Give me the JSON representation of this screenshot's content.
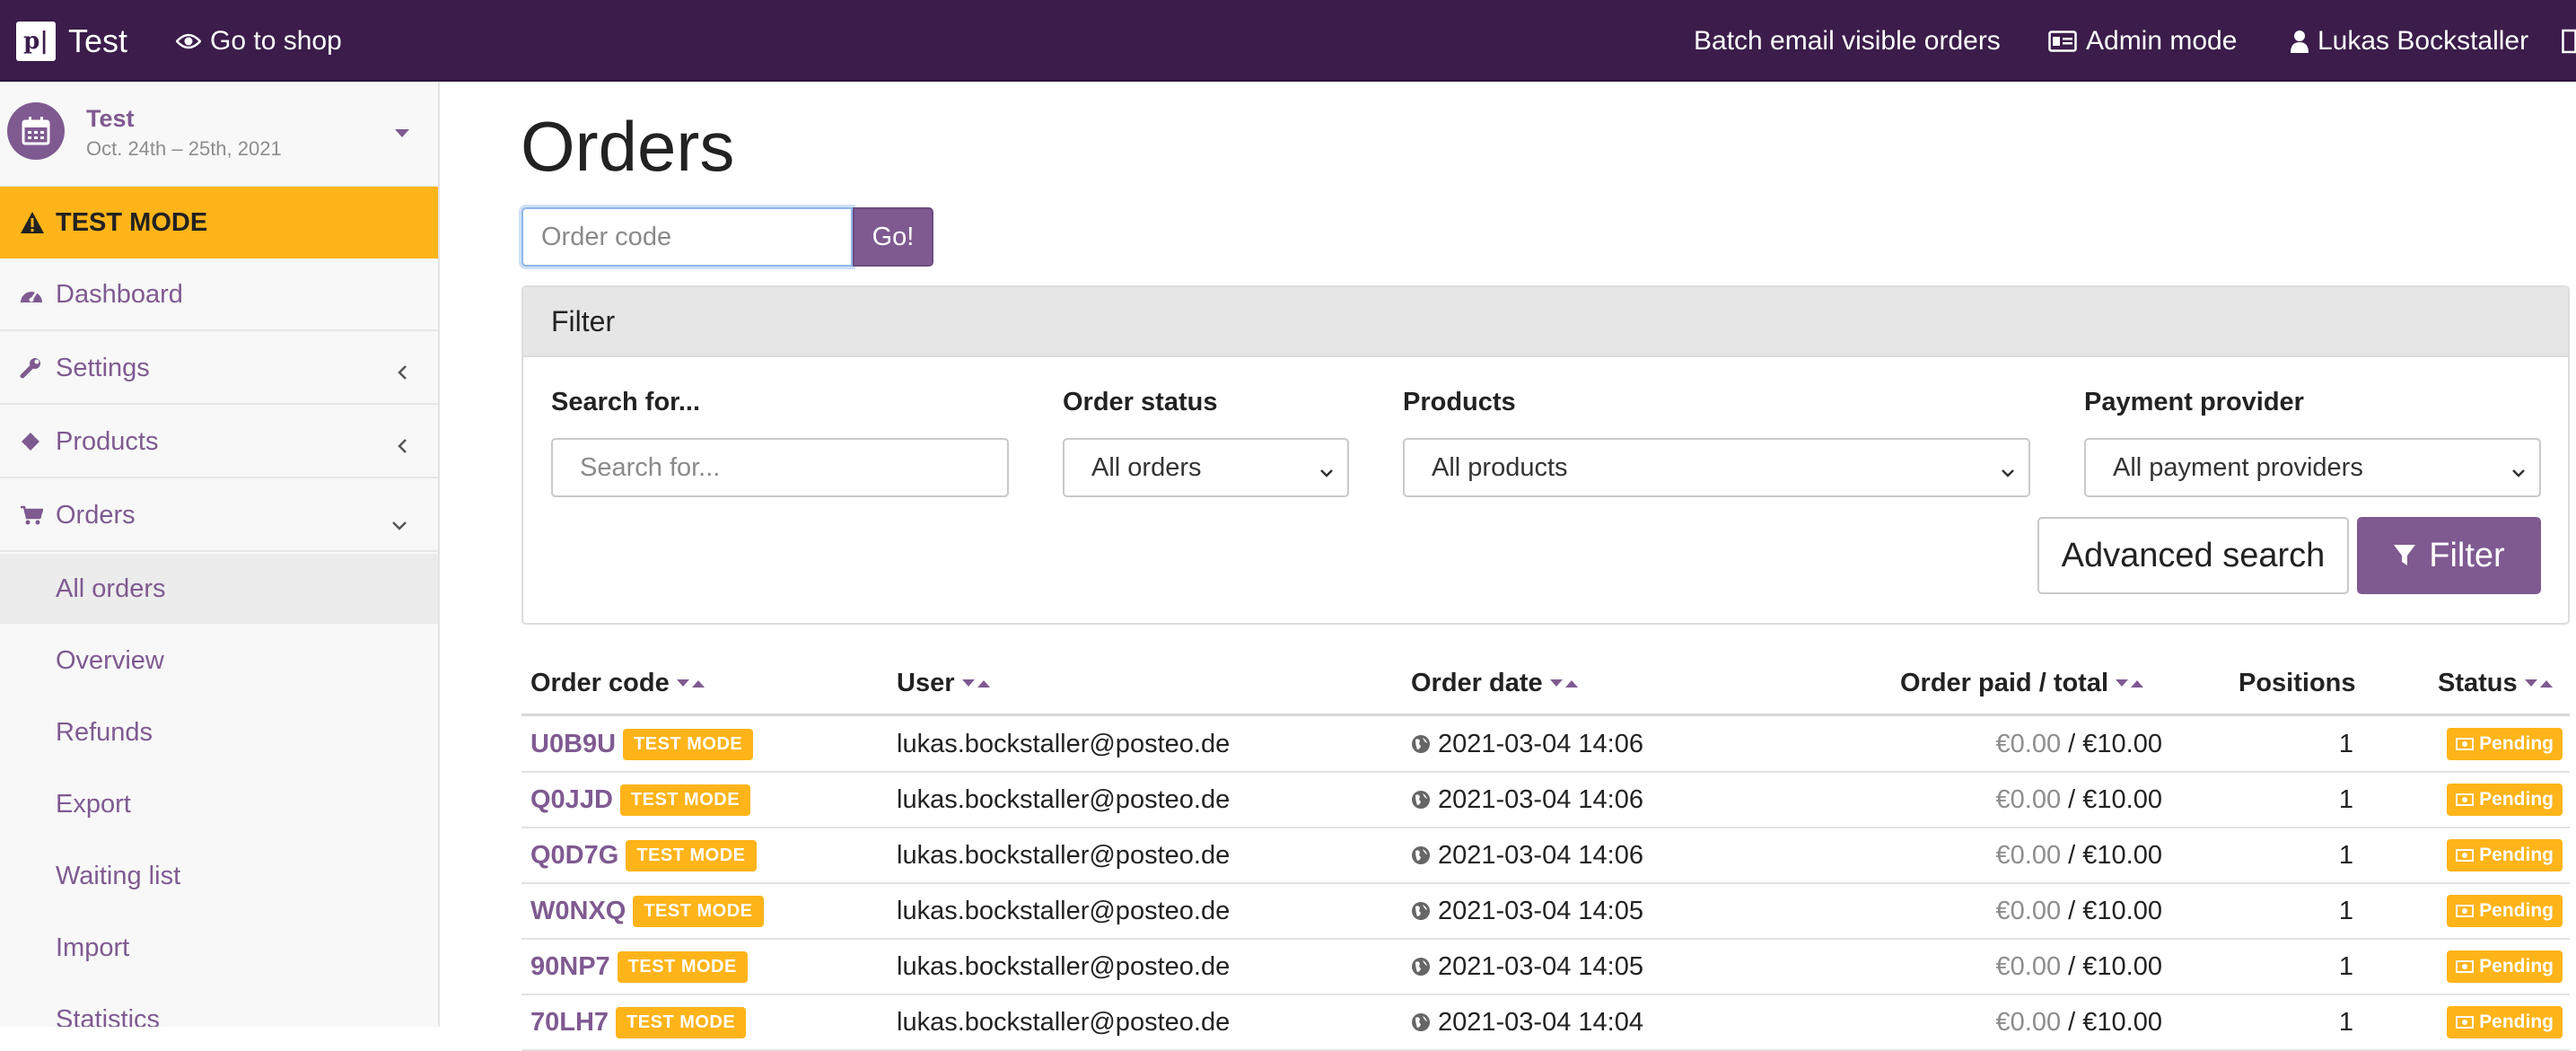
{
  "navbar": {
    "logo_text": "p|",
    "brand": "Test",
    "go_to_shop": "Go to shop",
    "batch_email": "Batch email visible orders",
    "admin_mode": "Admin mode",
    "user": "Lukas Bockstaller"
  },
  "sidebar": {
    "event_title": "Test",
    "event_date": "Oct. 24th – 25th, 2021",
    "test_mode": "TEST MODE",
    "items": [
      {
        "label": "Dashboard",
        "icon": "dashboard-icon"
      },
      {
        "label": "Settings",
        "icon": "wrench-icon",
        "chevron": "left"
      },
      {
        "label": "Products",
        "icon": "tickets-icon",
        "chevron": "left"
      },
      {
        "label": "Orders",
        "icon": "cart-icon",
        "chevron": "down"
      }
    ],
    "subitems": [
      {
        "label": "All orders",
        "active": true
      },
      {
        "label": "Overview"
      },
      {
        "label": "Refunds"
      },
      {
        "label": "Export"
      },
      {
        "label": "Waiting list"
      },
      {
        "label": "Import"
      },
      {
        "label": "Statistics"
      }
    ]
  },
  "main": {
    "title": "Orders",
    "order_code_placeholder": "Order code",
    "go_label": "Go!",
    "filter": {
      "heading": "Filter",
      "search_label": "Search for...",
      "search_placeholder": "Search for...",
      "status_label": "Order status",
      "status_value": "All orders",
      "products_label": "Products",
      "products_value": "All products",
      "provider_label": "Payment provider",
      "provider_value": "All payment providers",
      "advanced_label": "Advanced search",
      "filter_label": "Filter"
    },
    "table": {
      "headers": [
        "Order code",
        "User",
        "Order date",
        "Order paid / total",
        "Positions",
        "Status"
      ],
      "test_badge": "TEST MODE",
      "rows": [
        {
          "code": "U0B9U",
          "user": "lukas.bockstaller@posteo.de",
          "date": "2021-03-04 14:06",
          "paid": "€0.00",
          "total": "€10.00",
          "positions": "1",
          "status": "Pending"
        },
        {
          "code": "Q0JJD",
          "user": "lukas.bockstaller@posteo.de",
          "date": "2021-03-04 14:06",
          "paid": "€0.00",
          "total": "€10.00",
          "positions": "1",
          "status": "Pending"
        },
        {
          "code": "Q0D7G",
          "user": "lukas.bockstaller@posteo.de",
          "date": "2021-03-04 14:06",
          "paid": "€0.00",
          "total": "€10.00",
          "positions": "1",
          "status": "Pending"
        },
        {
          "code": "W0NXQ",
          "user": "lukas.bockstaller@posteo.de",
          "date": "2021-03-04 14:05",
          "paid": "€0.00",
          "total": "€10.00",
          "positions": "1",
          "status": "Pending"
        },
        {
          "code": "90NP7",
          "user": "lukas.bockstaller@posteo.de",
          "date": "2021-03-04 14:05",
          "paid": "€0.00",
          "total": "€10.00",
          "positions": "1",
          "status": "Pending"
        },
        {
          "code": "70LH7",
          "user": "lukas.bockstaller@posteo.de",
          "date": "2021-03-04 14:04",
          "paid": "€0.00",
          "total": "€10.00",
          "positions": "1",
          "status": "Pending"
        }
      ]
    }
  },
  "colors": {
    "navbar": "#3b1c4a",
    "accent": "#7f5a91",
    "warning": "#ffb419"
  }
}
